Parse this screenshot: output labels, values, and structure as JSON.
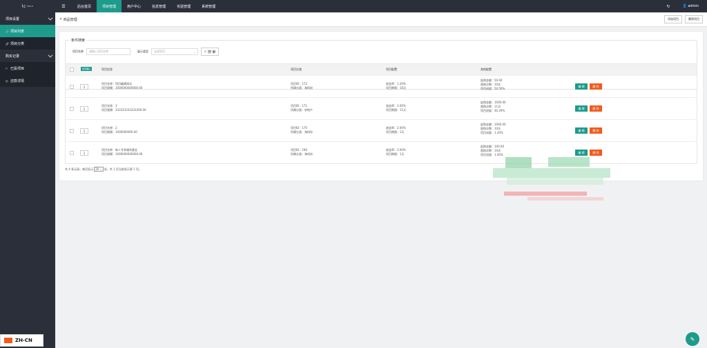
{
  "brand": {
    "logo": "lc",
    "sup": "TPL3"
  },
  "sidebar": {
    "groups": [
      {
        "label": "项目设置",
        "items": [
          {
            "label": "项目列表",
            "active": true,
            "icon": "link-icon"
          },
          {
            "label": "项目分类",
            "active": false,
            "icon": "link-icon"
          }
        ]
      },
      {
        "label": "购买记录",
        "items": [
          {
            "label": "已投项目",
            "active": false,
            "icon": "flag-icon"
          },
          {
            "label": "还款详情",
            "active": false,
            "icon": "clock-icon"
          }
        ]
      }
    ]
  },
  "lang": {
    "label": "ZH-CN"
  },
  "topbar": {
    "nav": [
      {
        "label": "后台首页",
        "active": false
      },
      {
        "label": "项目管理",
        "active": true
      },
      {
        "label": "用户中心",
        "active": false
      },
      {
        "label": "信息管理",
        "active": false
      },
      {
        "label": "实验管理",
        "active": false
      },
      {
        "label": "系统管理",
        "active": false
      }
    ],
    "user": "admin"
  },
  "breadcrumb": {
    "label": "商品管理"
  },
  "header_buttons": {
    "add": "添加项目",
    "delete": "删除项目"
  },
  "search": {
    "legend": "条件搜索",
    "name_label": "项目名称",
    "name_placeholder": "请输入项目名称",
    "type_label": "展示类型",
    "type_value": "全部项目",
    "button": "搜 索"
  },
  "table": {
    "sort_button": "排序确认",
    "headers": [
      "项目信息",
      "项目分类",
      "项目配置",
      "其他配置"
    ],
    "rows": [
      {
        "sort": "1",
        "name": "项目名称：项目编辑测试",
        "scale": "项目规模：1000000000000.00",
        "id": "项目ID：172",
        "cat": "所属分类：海科技",
        "rate": "收益率：1.20%",
        "period": "项目期限：10天",
        "min": "起购金额：50.00",
        "limit": "限购次数：10次",
        "progress": "项目进度：50.50%"
      },
      {
        "sort": "1",
        "name": "项目名称：3",
        "scale": "项目规模：333333333333300.00",
        "id": "项目ID：171",
        "cat": "所属分类：房地产",
        "rate": "收益率：3.00%",
        "period": "项目期限：11天",
        "min": "起购金额：1000.00",
        "limit": "限购次数：11次",
        "progress": "项目进度：46.29%"
      },
      {
        "sort": "1",
        "name": "项目名称：2",
        "scale": "项目规模：1000000000.00",
        "id": "项目ID：170",
        "cat": "所属分类：海科技",
        "rate": "收益率：2.00%",
        "period": "项目期限：1天",
        "min": "起购金额：1000.00",
        "limit": "限购次数：10次",
        "progress": "项目进度：1.20%"
      },
      {
        "sort": "1",
        "name": "项目名称：新人专享福利基金",
        "scale": "项目规模：1000000000000.00",
        "id": "项目ID：169",
        "cat": "所属分类：海科技",
        "rate": "收益率：3.00%",
        "period": "项目期限：1天",
        "min": "起购金额：100.00",
        "limit": "限购次数：10次",
        "progress": "项目进度：1.00%"
      }
    ],
    "edit": "编 辑",
    "delete": "删 除"
  },
  "footer": {
    "prefix": "共 4 条记录，每页显示",
    "page_size": "20",
    "suffix": "条，共 1 页当前显示第 1 页。"
  },
  "colors": {
    "accent": "#1d9b8b",
    "danger": "#f25a1c",
    "dark": "#2b2f3a"
  }
}
